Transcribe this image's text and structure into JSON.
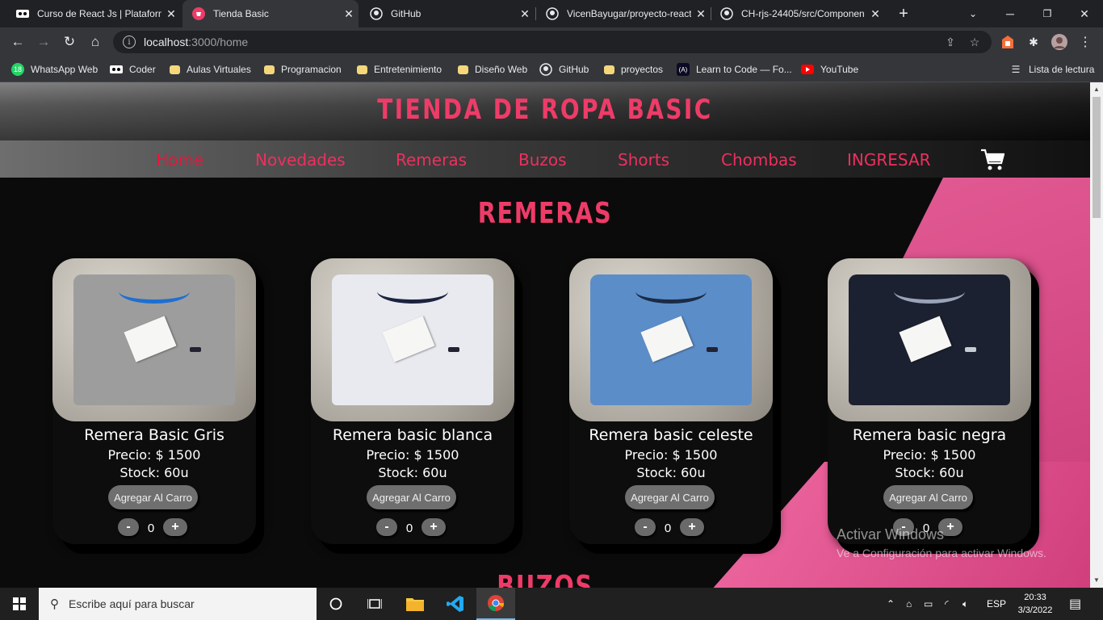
{
  "browser": {
    "tabs": [
      {
        "title": "Curso de React Js | Plataform",
        "icon": "coderhouse-icon"
      },
      {
        "title": "Tienda Basic",
        "icon": "site-icon",
        "active": true
      },
      {
        "title": "GitHub",
        "icon": "github-icon"
      },
      {
        "title": "VicenBayugar/proyecto-react",
        "icon": "github-icon"
      },
      {
        "title": "CH-rjs-24405/src/Componen",
        "icon": "github-icon"
      }
    ],
    "url_host": "localhost",
    "url_path": ":3000/home",
    "bookmarks": [
      {
        "label": "WhatsApp Web",
        "icon": "whatsapp-icon"
      },
      {
        "label": "Coder",
        "icon": "coderhouse-icon"
      },
      {
        "label": "Aulas Virtuales",
        "icon": "folder-icon"
      },
      {
        "label": "Programacion",
        "icon": "folder-icon"
      },
      {
        "label": "Entretenimiento",
        "icon": "folder-icon"
      },
      {
        "label": "Diseño Web",
        "icon": "folder-icon"
      },
      {
        "label": "GitHub",
        "icon": "github-icon"
      },
      {
        "label": "proyectos",
        "icon": "folder-icon"
      },
      {
        "label": "Learn to Code — Fo...",
        "icon": "freecodecamp-icon"
      },
      {
        "label": "YouTube",
        "icon": "youtube-icon"
      }
    ],
    "reading_list": "Lista de lectura",
    "whatsapp_badge": "18"
  },
  "site": {
    "title": "TIENDA DE ROPA BASIC",
    "nav": [
      "Home",
      "Novedades",
      "Remeras",
      "Buzos",
      "Shorts",
      "Chombas",
      "INGRESAR"
    ],
    "section_title": "REMERAS",
    "next_section_title": "BUZOS",
    "add_label": "Agregar Al Carro",
    "minus_label": "-",
    "plus_label": "+",
    "products": [
      {
        "name": "Remera Basic Gris",
        "price": "Precio: $ 1500",
        "stock": "Stock: 60u",
        "qty": "0",
        "color": "#9d9d9d",
        "collar": "#1e6fd0"
      },
      {
        "name": "Remera basic blanca",
        "price": "Precio: $ 1500",
        "stock": "Stock: 60u",
        "qty": "0",
        "color": "#e8eaf0",
        "collar": "#1c2340"
      },
      {
        "name": "Remera basic celeste",
        "price": "Precio: $ 1500",
        "stock": "Stock: 60u",
        "qty": "0",
        "color": "#5b8dc9",
        "collar": "#1b2b46"
      },
      {
        "name": "Remera basic negra",
        "price": "Precio: $ 1500",
        "stock": "Stock: 60u",
        "qty": "0",
        "color": "#1b2130",
        "collar": "#9aa3b8"
      }
    ]
  },
  "watermark": {
    "line1": "Activar Windows",
    "line2": "Ve a Configuración para activar Windows."
  },
  "taskbar": {
    "search_placeholder": "Escribe aquí para buscar",
    "lang": "ESP",
    "time": "20:33",
    "date": "3/3/2022"
  }
}
